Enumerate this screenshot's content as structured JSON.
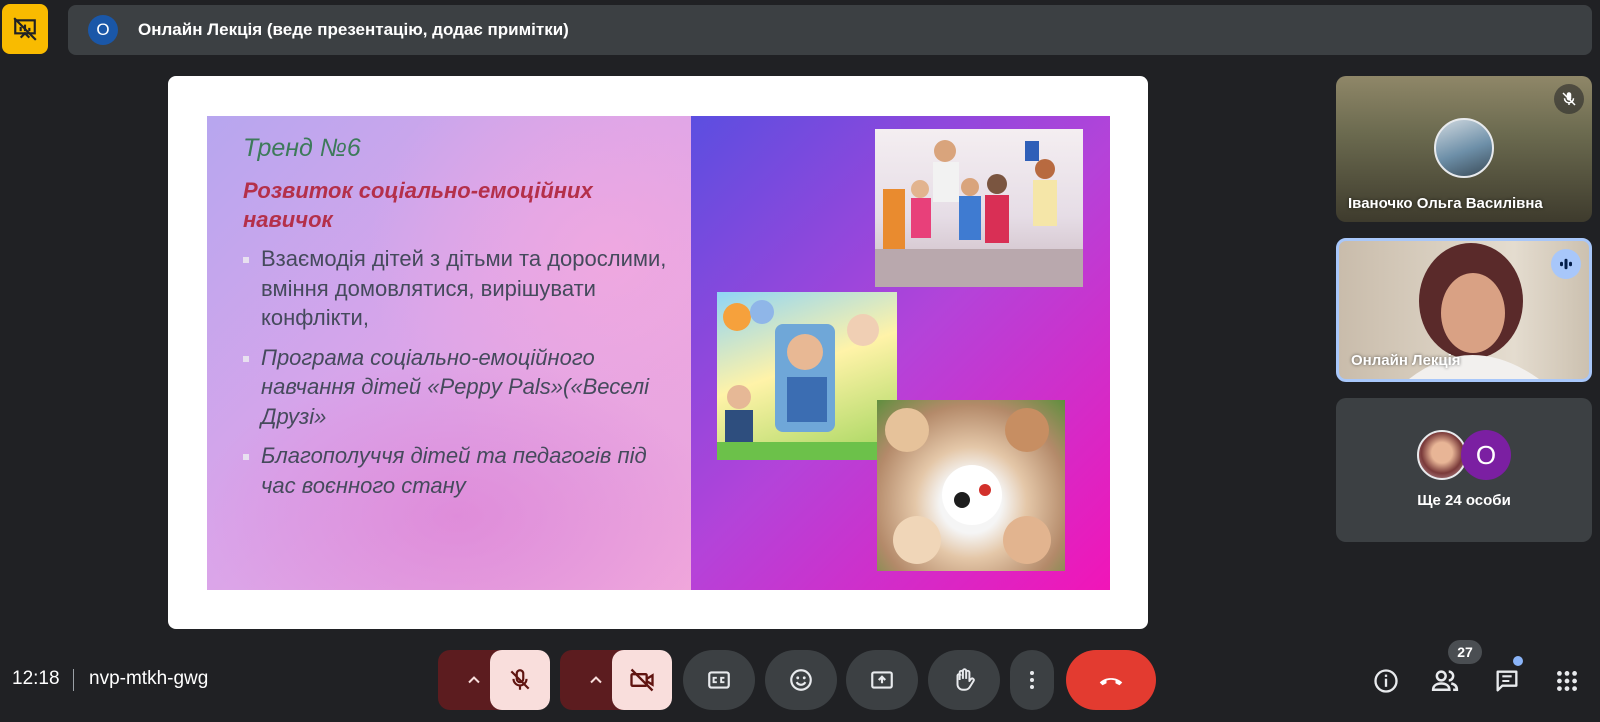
{
  "header": {
    "presenter_avatar_letter": "О",
    "title": "Онлайн Лекція (веде презентацію, додає примітки)"
  },
  "slide": {
    "trend": "Тренд №6",
    "heading": "Розвиток соціально-емоційних навичок",
    "bullets": [
      "Взаємодія дітей з дітьми та дорослими, вміння домовлятися, вирішувати конфлікти,",
      "Програма соціально-емоційного навчання дітей «Peppy Pals»(«Веселі Друзі»",
      "Благополуччя дітей та педагогів під час воєнного стану"
    ]
  },
  "participants": {
    "tile1_name": "Іваночко Ольга Василівна",
    "tile2_name": "Онлайн Лекція",
    "more_avatar_letter": "О",
    "more_label": "Ще 24 особи"
  },
  "bottom": {
    "time": "12:18",
    "meeting_code": "nvp-mtkh-gwg",
    "people_count": "27"
  },
  "colors": {
    "presenting_badge": "#f9bb00",
    "end_call": "#e33b30",
    "mic_off_bg": "#f9dedc",
    "active_tile_border": "#a8c7fa"
  },
  "icons": [
    "presentation-off-icon",
    "mic-off-icon",
    "camera-off-icon",
    "captions-icon",
    "emoji-icon",
    "present-icon",
    "raise-hand-icon",
    "more-options-icon",
    "end-call-icon",
    "info-icon",
    "people-icon",
    "chat-icon",
    "activities-icon"
  ]
}
